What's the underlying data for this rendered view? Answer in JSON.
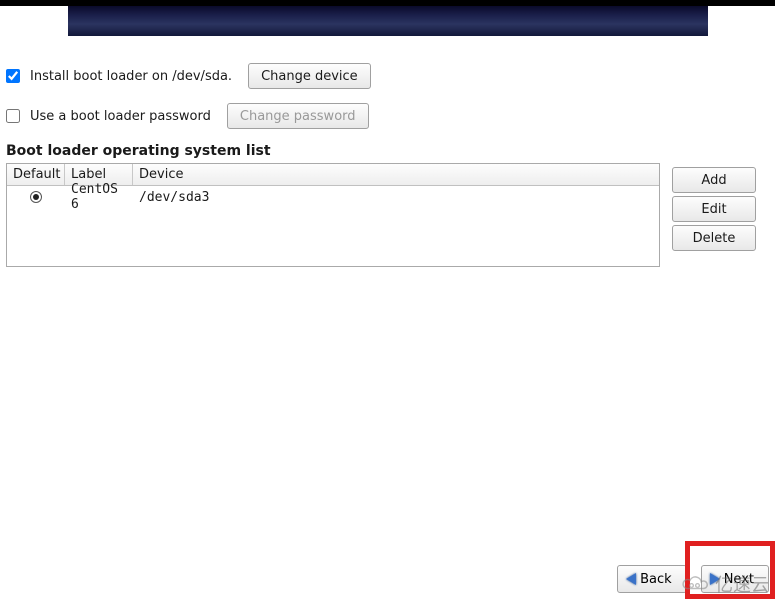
{
  "bootloader": {
    "install_checked": true,
    "install_label": "Install boot loader on /dev/sda.",
    "change_device_label": "Change device",
    "password_checked": false,
    "password_label": "Use a boot loader password",
    "change_password_label": "Change password"
  },
  "os_list": {
    "heading": "Boot loader operating system list",
    "columns": {
      "default": "Default",
      "label": "Label",
      "device": "Device"
    },
    "rows": [
      {
        "default": true,
        "label": "CentOS 6",
        "device": "/dev/sda3"
      }
    ]
  },
  "side_buttons": {
    "add": "Add",
    "edit": "Edit",
    "delete": "Delete"
  },
  "nav": {
    "back": "Back",
    "next": "Next"
  },
  "watermark": "亿速云"
}
